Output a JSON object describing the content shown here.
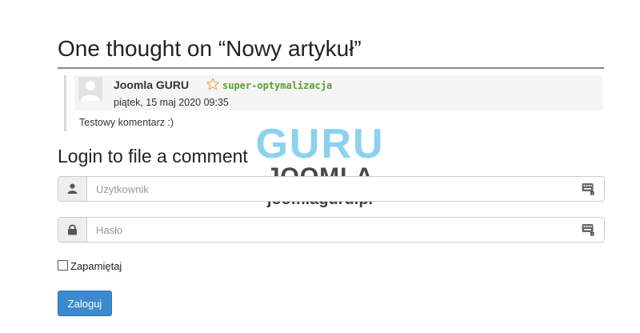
{
  "top_fragment": "",
  "comments_heading": "One thought on “Nowy artykuł”",
  "comment": {
    "author": "Joomla GURU",
    "tag": "super-optymalizacja",
    "date": "piątek, 15 maj 2020 09:35",
    "text": "Testowy komentarz :)"
  },
  "watermark": {
    "line1": "GURU",
    "line2": "JOOMLA",
    "line3": "joomlaguru.pl"
  },
  "login": {
    "title": "Login to file a comment",
    "username_placeholder": "Użytkownik",
    "password_placeholder": "Hasło",
    "remember_label": "Zapamiętaj",
    "submit_label": "Zaloguj"
  },
  "colors": {
    "tag_green": "#5aa02c",
    "button_blue": "#3d89cf",
    "star_orange": "#f0ad4e",
    "watermark_blue": "#78c8f0"
  },
  "icons": [
    "user-icon",
    "lock-icon",
    "keyboard-icon",
    "star-icon",
    "avatar-icon"
  ]
}
